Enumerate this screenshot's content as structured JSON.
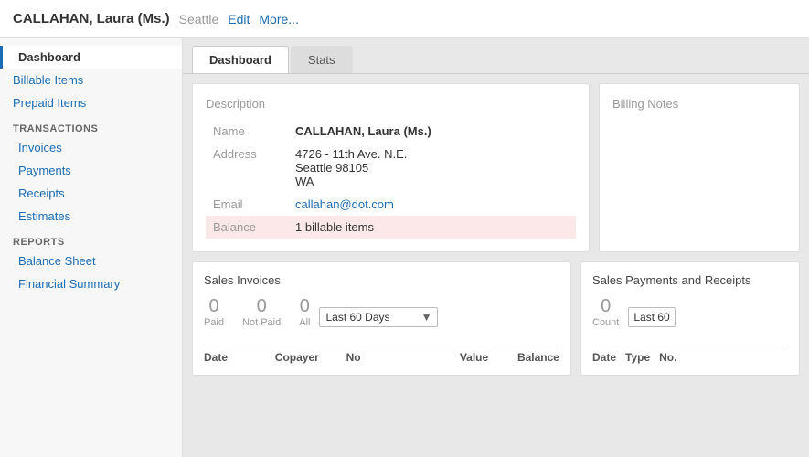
{
  "header": {
    "name": "CALLAHAN, Laura (Ms.)",
    "city": "Seattle",
    "edit_label": "Edit",
    "more_label": "More..."
  },
  "sidebar": {
    "items": [
      {
        "id": "dashboard",
        "label": "Dashboard",
        "active": true,
        "section": false
      },
      {
        "id": "billable-items",
        "label": "Billable Items",
        "active": false,
        "section": false
      },
      {
        "id": "prepaid-items",
        "label": "Prepaid Items",
        "active": false,
        "section": false
      }
    ],
    "transactions_section": "TRANSACTIONS",
    "transactions_items": [
      {
        "id": "invoices",
        "label": "Invoices"
      },
      {
        "id": "payments",
        "label": "Payments"
      },
      {
        "id": "receipts",
        "label": "Receipts"
      },
      {
        "id": "estimates",
        "label": "Estimates"
      }
    ],
    "reports_section": "REPORTS",
    "reports_items": [
      {
        "id": "balance-sheet",
        "label": "Balance Sheet"
      },
      {
        "id": "financial-summary",
        "label": "Financial Summary"
      }
    ]
  },
  "tabs": [
    {
      "id": "dashboard",
      "label": "Dashboard",
      "active": true
    },
    {
      "id": "stats",
      "label": "Stats",
      "active": false
    }
  ],
  "description": {
    "title": "Description",
    "fields": {
      "name_label": "Name",
      "name_value": "CALLAHAN, Laura (Ms.)",
      "address_label": "Address",
      "address_line1": "4726 - 11th Ave. N.E.",
      "address_line2": "Seattle 98105",
      "address_line3": "WA",
      "email_label": "Email",
      "email_value": "callahan@dot.com",
      "balance_label": "Balance",
      "balance_value": "1 billable items"
    }
  },
  "billing_notes": {
    "title": "Billing Notes"
  },
  "sales_invoices": {
    "title": "Sales Invoices",
    "paid_count": "0",
    "paid_label": "Paid",
    "not_paid_count": "0",
    "not_paid_label": "Not Paid",
    "all_count": "0",
    "all_label": "All",
    "dropdown_value": "Last 60 Days",
    "columns": [
      {
        "label": "Date"
      },
      {
        "label": "Copayer"
      },
      {
        "label": "No"
      },
      {
        "label": "Value"
      },
      {
        "label": "Balance"
      }
    ]
  },
  "sales_payments": {
    "title": "Sales Payments and Receipts",
    "count_num": "0",
    "count_label": "Count",
    "dropdown_value": "Last 60",
    "columns": [
      {
        "label": "Date"
      },
      {
        "label": "Type"
      },
      {
        "label": "No."
      }
    ]
  }
}
